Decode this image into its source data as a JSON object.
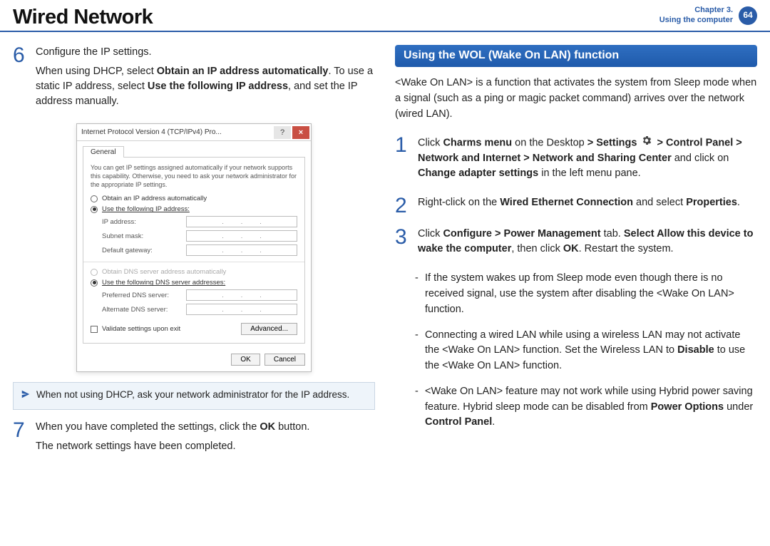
{
  "header": {
    "title": "Wired Network",
    "chapter": "Chapter 3.",
    "section": "Using the computer",
    "page": "64"
  },
  "left": {
    "step6": {
      "num": "6",
      "line1": "Configure the IP settings.",
      "line2a": "When using DHCP, select ",
      "line2b": "Obtain an IP address automatically",
      "line2c": ". To use a static IP address, select ",
      "line2d": "Use the following IP address",
      "line2e": ", and set the IP address manually."
    },
    "dialog": {
      "title": "Internet Protocol Version 4 (TCP/IPv4) Pro...",
      "tab": "General",
      "note": "You can get IP settings assigned automatically if your network supports this capability. Otherwise, you need to ask your network administrator for the appropriate IP settings.",
      "r1": "Obtain an IP address automatically",
      "r2": "Use the following IP address:",
      "f_ip": "IP address:",
      "f_mask": "Subnet mask:",
      "f_gw": "Default gateway:",
      "r3": "Obtain DNS server address automatically",
      "r4": "Use the following DNS server addresses:",
      "f_pdns": "Preferred DNS server:",
      "f_adns": "Alternate DNS server:",
      "chk": "Validate settings upon exit",
      "adv": "Advanced...",
      "ok": "OK",
      "cancel": "Cancel"
    },
    "info": "When not using DHCP, ask your network administrator for the IP address.",
    "step7": {
      "num": "7",
      "line1a": "When you have completed the settings, click the ",
      "line1b": "OK",
      "line1c": " button.",
      "line2": "The network settings have been completed."
    }
  },
  "right": {
    "bar": "Using the WOL (Wake On LAN) function",
    "intro": "<Wake On LAN> is a function that activates the system from Sleep mode when a signal (such as a ping or magic packet command) arrives over the network (wired LAN).",
    "step1": {
      "num": "1",
      "a": "Click ",
      "b": "Charms menu",
      "c": " on the Desktop ",
      "d": ">",
      "e": " Settings ",
      "f": " > ",
      "g": "Control Panel > Network and Internet > Network and Sharing Center",
      "h": " and click on ",
      "i": "Change adapter settings",
      "j": " in the left menu pane."
    },
    "step2": {
      "num": "2",
      "a": "Right-click on the ",
      "b": "Wired Ethernet Connection",
      "c": " and select ",
      "d": "Properties",
      "e": "."
    },
    "step3": {
      "num": "3",
      "a": "Click ",
      "b": "Configure > Power Management",
      "c": " tab. ",
      "d": "Select Allow this device to wake the computer",
      "e": ", then click ",
      "f": "OK",
      "g": ". Restart the system."
    },
    "bul1": "If the system wakes up from Sleep mode even though there is no received signal, use the system after disabling the <Wake On LAN> function.",
    "bul2a": "Connecting a wired LAN while using a wireless LAN may not activate the <Wake On LAN> function. Set the Wireless LAN to ",
    "bul2b": "Disable",
    "bul2c": " to use the <Wake On LAN> function.",
    "bul3a": "<Wake On LAN> feature may not work while using Hybrid power saving feature. Hybrid sleep mode can be disabled from ",
    "bul3b": "Power Options",
    "bul3c": " under ",
    "bul3d": "Control Panel",
    "bul3e": "."
  }
}
